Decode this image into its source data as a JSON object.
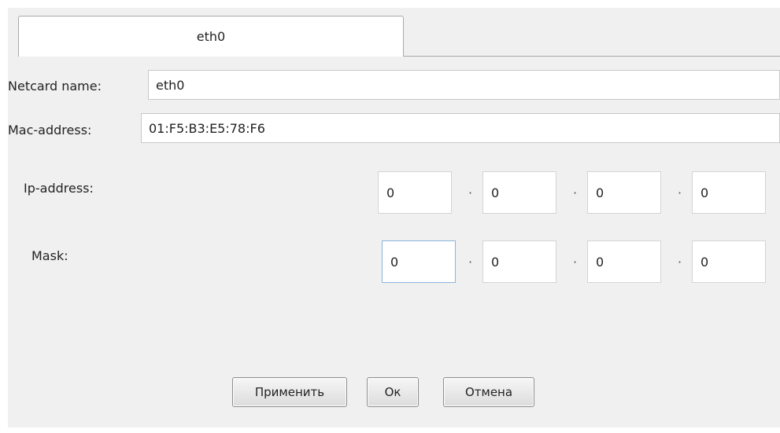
{
  "tabs": [
    {
      "label": "eth0",
      "selected": true
    }
  ],
  "form": {
    "netcard_label": "Netcard name:",
    "netcard_value": "eth0",
    "mac_label": "Mac-address:",
    "mac_value": "01:F5:B3:E5:78:F6",
    "ip_label": "Ip-address:",
    "ip_octets": [
      "0",
      "0",
      "0",
      "0"
    ],
    "mask_label": "Mask:",
    "mask_octets": [
      "0",
      "0",
      "0",
      "0"
    ],
    "separator": "·"
  },
  "buttons": {
    "apply": "Применить",
    "ok": "Ок",
    "cancel": "Отмена"
  },
  "colors": {
    "panel": "#f0f0f0",
    "input_border": "#c8c8c8",
    "focus_border": "#8ab4dc"
  }
}
